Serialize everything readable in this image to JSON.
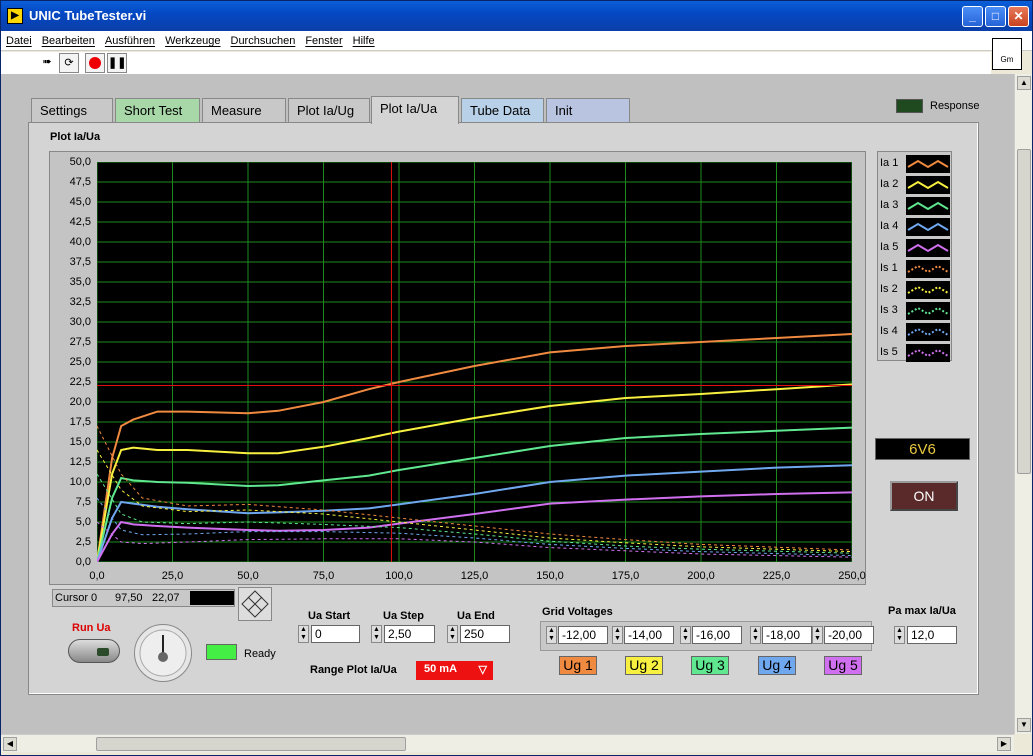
{
  "window": {
    "title": "UNIC TubeTester.vi",
    "minimize": "_",
    "maximize": "□",
    "close": "✕"
  },
  "menu": [
    "Datei",
    "Bearbeiten",
    "Ausführen",
    "Werkzeuge",
    "Durchsuchen",
    "Fenster",
    "Hilfe"
  ],
  "vi_icon_text": "Gm",
  "tabs": [
    "Settings",
    "Short Test",
    "Measure",
    "Plot Ia/Ug",
    "Plot Ia/Ua",
    "Tube Data",
    "Init"
  ],
  "tab_colors": [
    "#c8c8c8",
    "#a8d8a8",
    "#c8c8c8",
    "#c8c8c8",
    "#d4d4d4",
    "#b8d0e8",
    "#b8c4e0"
  ],
  "active_tab": "Plot Ia/Ua",
  "response_label": "Response",
  "plot_title": "Plot Ia/Ua",
  "legend": [
    "Ia 1",
    "Ia 2",
    "Ia 3",
    "Ia 4",
    "Ia 5",
    "Is 1",
    "Is 2",
    "Is 3",
    "Is 4",
    "Is 5"
  ],
  "tube_name": "6V6",
  "on_label": "ON",
  "cursor": {
    "name": "Cursor 0",
    "x": "97,50",
    "y": "22,07"
  },
  "run_label": "Run Ua",
  "ready_label": "Ready",
  "ua_start": {
    "label": "Ua Start",
    "value": "0"
  },
  "ua_step": {
    "label": "Ua Step",
    "value": "2,50"
  },
  "ua_end": {
    "label": "Ua End",
    "value": "250"
  },
  "range": {
    "label": "Range Plot Ia/Ua",
    "value": "50 mA"
  },
  "grid": {
    "label": "Grid Voltages",
    "values": [
      "-12,00",
      "-14,00",
      "-16,00",
      "-18,00",
      "-20,00"
    ]
  },
  "ug_buttons": [
    "Ug 1",
    "Ug 2",
    "Ug 3",
    "Ug 4",
    "Ug 5"
  ],
  "ug_colors": [
    "#f08a40",
    "#f8f040",
    "#60e890",
    "#70a8f0",
    "#d070f0"
  ],
  "pa_max": {
    "label": "Pa max Ia/Ua",
    "value": "12,0"
  },
  "chart_data": {
    "type": "line",
    "xlim": [
      0,
      250
    ],
    "ylim": [
      0,
      50
    ],
    "x_ticks": [
      "0,0",
      "25,0",
      "50,0",
      "75,0",
      "100,0",
      "125,0",
      "150,0",
      "175,0",
      "200,0",
      "225,0",
      "250,0"
    ],
    "y_ticks": [
      "0,0",
      "2,5",
      "5,0",
      "7,5",
      "10,0",
      "12,5",
      "15,0",
      "17,5",
      "20,0",
      "22,5",
      "25,0",
      "27,5",
      "30,0",
      "32,5",
      "35,0",
      "37,5",
      "40,0",
      "42,5",
      "45,0",
      "47,5",
      "50,0"
    ],
    "grid": true,
    "cursor": {
      "x": 97.5,
      "y": 22.07
    },
    "series": [
      {
        "name": "Ia 1",
        "color": "#f08a40",
        "dashed": false,
        "x": [
          0,
          5,
          8,
          12,
          20,
          30,
          50,
          60,
          75,
          90,
          100,
          125,
          150,
          175,
          200,
          225,
          250
        ],
        "y": [
          0,
          13,
          17,
          17.8,
          18.8,
          18.8,
          18.6,
          18.9,
          20,
          21.6,
          22.5,
          24.5,
          26.2,
          27,
          27.5,
          28,
          28.5
        ]
      },
      {
        "name": "Ia 2",
        "color": "#f8f040",
        "dashed": false,
        "x": [
          0,
          5,
          8,
          12,
          20,
          30,
          50,
          60,
          75,
          90,
          100,
          125,
          150,
          175,
          200,
          225,
          250
        ],
        "y": [
          0,
          11,
          14,
          14.3,
          14,
          14,
          13.6,
          13.6,
          14.4,
          15.5,
          16.3,
          18,
          19.5,
          20.5,
          21,
          21.6,
          22.2
        ]
      },
      {
        "name": "Ia 3",
        "color": "#60e890",
        "dashed": false,
        "x": [
          0,
          5,
          8,
          12,
          20,
          30,
          50,
          60,
          75,
          90,
          100,
          125,
          150,
          175,
          200,
          225,
          250
        ],
        "y": [
          0,
          8,
          10.5,
          10.2,
          10,
          9.9,
          9.5,
          9.6,
          10.2,
          10.8,
          11.5,
          13,
          14.5,
          15.5,
          16,
          16.4,
          16.8
        ]
      },
      {
        "name": "Ia 4",
        "color": "#70a8f0",
        "dashed": false,
        "x": [
          0,
          5,
          8,
          12,
          20,
          30,
          50,
          60,
          75,
          90,
          100,
          125,
          150,
          175,
          200,
          225,
          250
        ],
        "y": [
          0,
          5.5,
          7.5,
          7.3,
          6.9,
          6.6,
          6.1,
          6.2,
          6.4,
          6.7,
          7.2,
          8.5,
          10,
          10.8,
          11.3,
          11.8,
          12.1
        ]
      },
      {
        "name": "Ia 5",
        "color": "#d070f0",
        "dashed": false,
        "x": [
          0,
          5,
          8,
          12,
          20,
          30,
          50,
          60,
          75,
          90,
          100,
          125,
          150,
          175,
          200,
          225,
          250
        ],
        "y": [
          0,
          3.5,
          5,
          4.7,
          4.5,
          4.3,
          4,
          3.9,
          4,
          4.3,
          4.8,
          6,
          7.3,
          7.8,
          8.2,
          8.5,
          8.7
        ]
      },
      {
        "name": "Is 1",
        "color": "#f08a40",
        "dashed": true,
        "x": [
          0,
          8,
          15,
          30,
          50,
          75,
          100,
          125,
          150,
          175,
          200,
          250
        ],
        "y": [
          17,
          11,
          8,
          7,
          7.2,
          6.5,
          5.5,
          4.5,
          3.5,
          2.8,
          2.2,
          1.5
        ]
      },
      {
        "name": "Is 2",
        "color": "#f8f040",
        "dashed": true,
        "x": [
          0,
          8,
          15,
          30,
          50,
          75,
          100,
          125,
          150,
          175,
          200,
          250
        ],
        "y": [
          14,
          9,
          7,
          6.3,
          6.5,
          6,
          5,
          4,
          3,
          2.4,
          1.9,
          1.3
        ]
      },
      {
        "name": "Is 3",
        "color": "#60e890",
        "dashed": true,
        "x": [
          0,
          8,
          15,
          30,
          50,
          75,
          100,
          125,
          150,
          175,
          200,
          250
        ],
        "y": [
          11,
          6,
          5,
          4.8,
          5,
          4.7,
          4.3,
          3.5,
          2.6,
          2,
          1.6,
          1.1
        ]
      },
      {
        "name": "Is 4",
        "color": "#70a8f0",
        "dashed": true,
        "x": [
          0,
          8,
          15,
          30,
          50,
          75,
          100,
          125,
          150,
          175,
          200,
          250
        ],
        "y": [
          8,
          4,
          3.4,
          3.5,
          3.8,
          3.8,
          3.6,
          3,
          2.2,
          1.7,
          1.3,
          0.8
        ]
      },
      {
        "name": "Is 5",
        "color": "#d070f0",
        "dashed": true,
        "x": [
          0,
          8,
          15,
          30,
          50,
          75,
          100,
          125,
          150,
          175,
          200,
          250
        ],
        "y": [
          5,
          2.5,
          2.3,
          2.5,
          2.8,
          2.9,
          2.9,
          2.5,
          1.8,
          1.4,
          1,
          0.6
        ]
      }
    ]
  }
}
